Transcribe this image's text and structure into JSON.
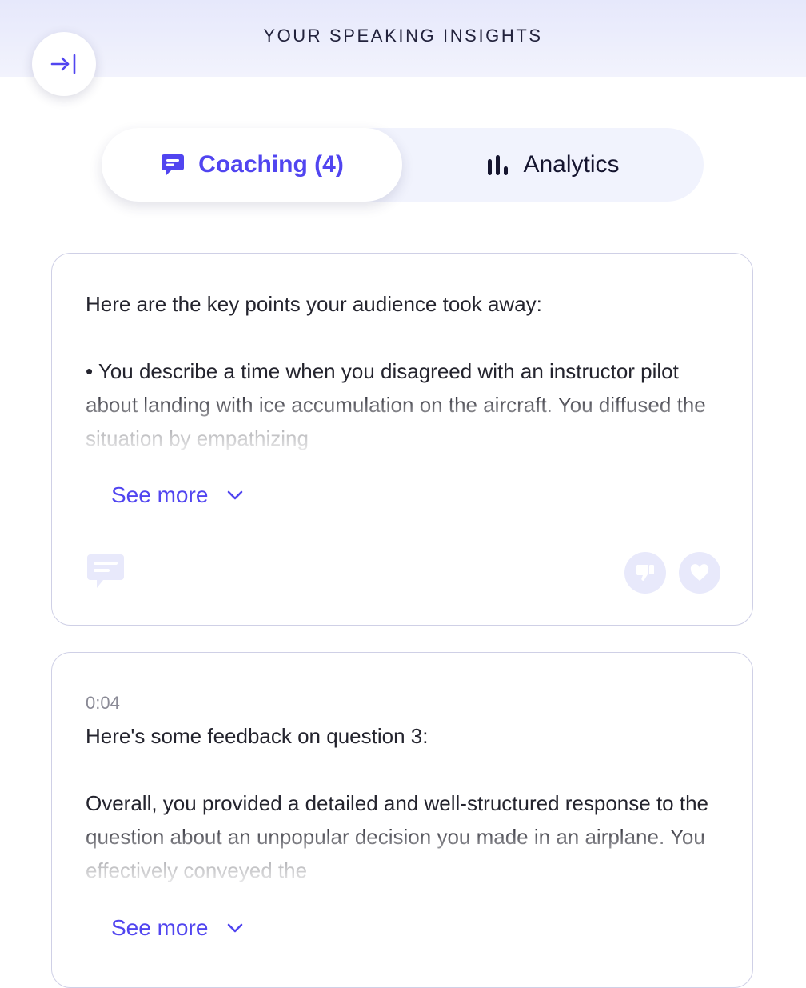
{
  "header": {
    "title": "YOUR SPEAKING INSIGHTS",
    "collapse_icon": "arrow-right-to-bar-icon"
  },
  "tabs": [
    {
      "label": "Coaching (4)",
      "icon": "chat-bubble-icon",
      "active": true
    },
    {
      "label": "Analytics",
      "icon": "bar-chart-icon",
      "active": false
    }
  ],
  "cards": [
    {
      "intro": "Here are the key points your audience took away:",
      "body": "• You describe a time when you disagreed with an instructor pilot about landing with ice accumulation on the aircraft. You diffused the situation by empathizing",
      "see_more": "See more"
    },
    {
      "timestamp": "0:04",
      "intro": "Here's some feedback on question 3:",
      "body": "Overall, you provided a detailed and well-structured response to the question about an unpopular decision you made in an airplane. You effectively conveyed the",
      "see_more": "See more"
    }
  ],
  "colors": {
    "accent": "#5145f0",
    "header_bg": "#e6e8fb",
    "icon_muted": "#e8e9fb",
    "card_border": "#cfd0e6"
  }
}
